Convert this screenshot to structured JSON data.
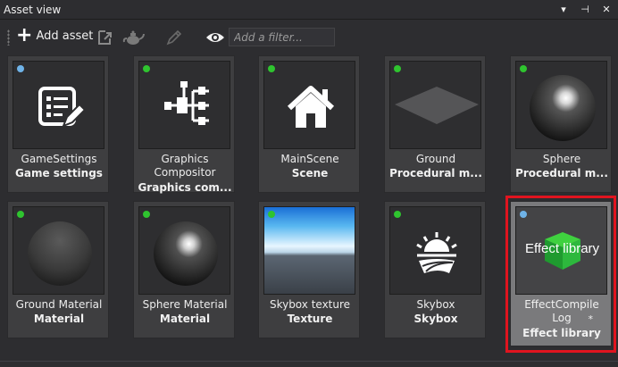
{
  "window": {
    "title": "Asset view",
    "controls": [
      "▾",
      "⊣",
      "✕"
    ]
  },
  "toolbar": {
    "add_asset_label": "Add asset",
    "filter_placeholder": "Add a filter...",
    "icons": [
      "plus-icon",
      "import-icon",
      "teapot-icon",
      "pencil-icon",
      "eye-icon"
    ]
  },
  "assets": [
    {
      "name": "GameSettings",
      "type": "Game settings",
      "status": "blue",
      "icon": "settings-list-icon"
    },
    {
      "name": "Graphics Compositor",
      "name_lines": [
        "Graphics",
        "Compositor"
      ],
      "type": "Graphics com...",
      "status": "green",
      "icon": "compositor-graph-icon"
    },
    {
      "name": "MainScene",
      "type": "Scene",
      "status": "green",
      "icon": "house-icon"
    },
    {
      "name": "Ground",
      "type": "Procedural m...",
      "status": "green",
      "icon": "plane-thumbnail"
    },
    {
      "name": "Sphere",
      "type": "Procedural m...",
      "status": "green",
      "icon": "sphere-thumbnail"
    },
    {
      "name": "Ground Material",
      "type": "Material",
      "status": "green",
      "icon": "matte-sphere-thumbnail"
    },
    {
      "name": "Sphere Material",
      "type": "Material",
      "status": "green",
      "icon": "glossy-sphere-thumbnail"
    },
    {
      "name": "Skybox texture",
      "type": "Texture",
      "status": "green",
      "icon": "sky-thumbnail"
    },
    {
      "name": "Skybox",
      "type": "Skybox",
      "status": "green",
      "icon": "sunrise-icon"
    },
    {
      "name": "EffectCompileLog",
      "name_lines": [
        "EffectCompile",
        "Log"
      ],
      "type": "Effect library",
      "status": "blue",
      "icon": "effect-library-thumbnail",
      "thumb_text": "Effect library",
      "modified_marker": "*",
      "selected": true
    }
  ],
  "colors": {
    "status_green": "#2fc42f",
    "status_blue": "#6fb3e8",
    "selection_highlight": "#e0141f",
    "tile_bg": "#3e3e40"
  }
}
